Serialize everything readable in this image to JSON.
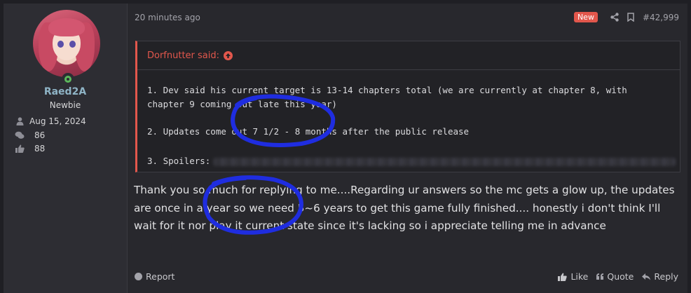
{
  "user": {
    "name": "Raed2A",
    "title": "Newbie",
    "joined": "Aug 15, 2024",
    "messages": "86",
    "reactions": "88"
  },
  "post": {
    "time": "20 minutes ago",
    "badge": "New",
    "number": "#42,999",
    "quote": {
      "author": "Dorfnutter said:",
      "line1": "1. Dev said his current target is 13-14 chapters total (we are currently at chapter 8, with chapter 9 coming out late this year)",
      "line2": "2. Updates come out 7 1/2 - 8 months after the public release",
      "line3": "3. Spoilers:"
    },
    "body": "Thank you so much for replying to me....Regarding ur answers so the mc gets a glow up, the updates are once in a year so we need 5~6 years to get this game fully finished.... honestly i don't think I'll wait for it nor play it current state since it's lacking so i appreciate telling me in advance"
  },
  "footer": {
    "report": "Report",
    "like": "Like",
    "quote": "Quote",
    "reply": "Reply"
  },
  "colors": {
    "accent": "#e2574c",
    "username": "#8fb4c6",
    "annotation": "#1f2de0",
    "online": "#5cb85c"
  },
  "icons": [
    "user-icon",
    "messages-icon",
    "thumbs-up-icon",
    "share-icon",
    "bookmark-icon",
    "arrow-up-icon",
    "report-icon",
    "quote-icon",
    "reply-icon"
  ]
}
